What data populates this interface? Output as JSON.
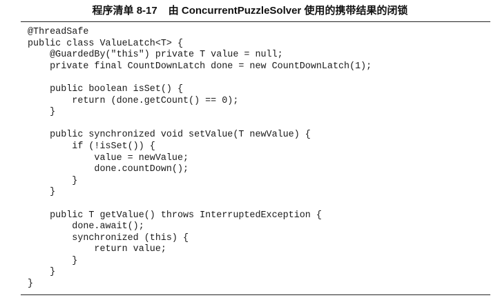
{
  "listing": {
    "label": "程序清单 8-17",
    "caption": "由 ConcurrentPuzzleSolver 使用的携带结果的闭锁",
    "lines": [
      "@ThreadSafe",
      "public class ValueLatch<T> {",
      "    @GuardedBy(\"this\") private T value = null;",
      "    private final CountDownLatch done = new CountDownLatch(1);",
      "",
      "    public boolean isSet() {",
      "        return (done.getCount() == 0);",
      "    }",
      "",
      "    public synchronized void setValue(T newValue) {",
      "        if (!isSet()) {",
      "            value = newValue;",
      "            done.countDown();",
      "        }",
      "    }",
      "",
      "    public T getValue() throws InterruptedException {",
      "        done.await();",
      "        synchronized (this) {",
      "            return value;",
      "        }",
      "    }",
      "}"
    ]
  }
}
